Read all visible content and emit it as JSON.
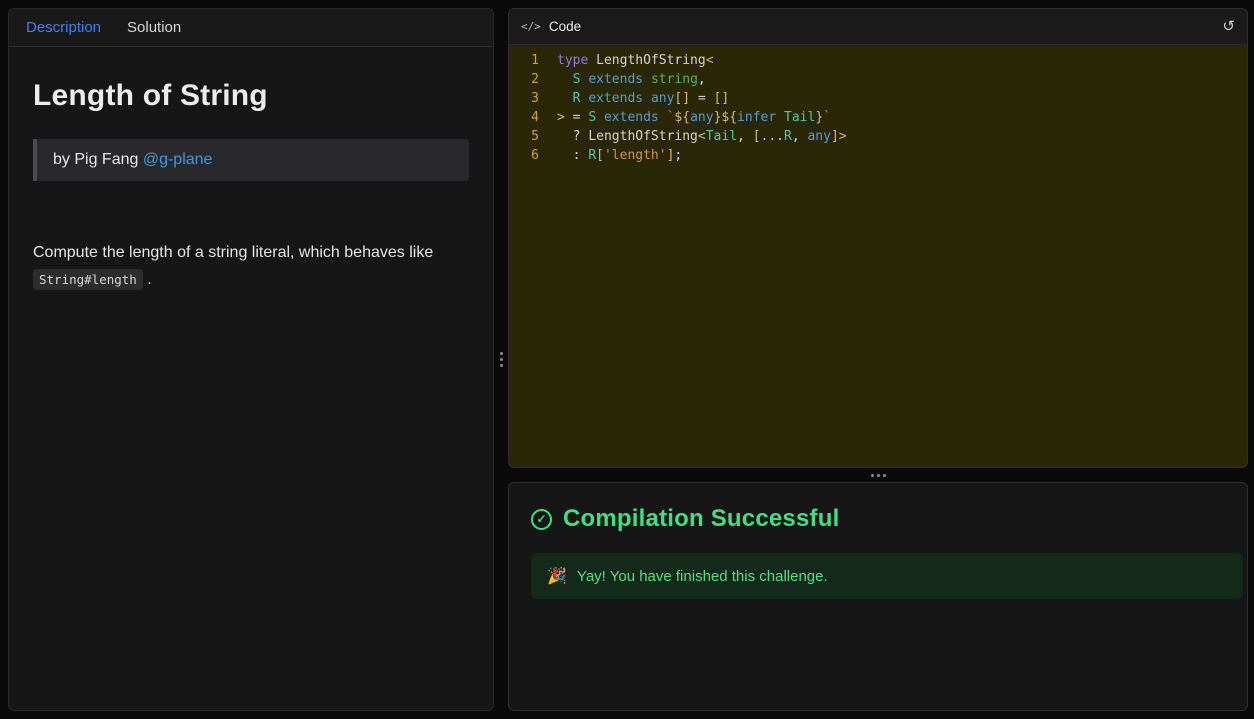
{
  "colors": {
    "accent_blue": "#3b82f6",
    "link_blue": "#3b9ae0",
    "success_green": "#3fe081",
    "editor_background": "#2a2706",
    "line_number": "#cfa43b"
  },
  "left_panel": {
    "tabs": [
      {
        "label": "Description",
        "active": true
      },
      {
        "label": "Solution",
        "active": false
      }
    ],
    "title": "Length of String",
    "byline": {
      "text": "by Pig Fang ",
      "link": "@g-plane"
    },
    "description": {
      "text": "Compute the length of a string literal, which behaves like ",
      "code": "String#length",
      "suffix": " ."
    }
  },
  "editor_panel": {
    "header": {
      "icon": "</>",
      "title": "Code",
      "reset_icon": "↺"
    },
    "code": {
      "lines": [
        {
          "num": "1",
          "tokens": [
            {
              "t": "type",
              "c": "kw2"
            },
            {
              "t": " ",
              "c": "pl"
            },
            {
              "t": "LengthOfString",
              "c": "pl"
            },
            {
              "t": "<",
              "c": "gold"
            }
          ]
        },
        {
          "num": "2",
          "tokens": [
            {
              "t": "  ",
              "c": "pl"
            },
            {
              "t": "S",
              "c": "tp"
            },
            {
              "t": " ",
              "c": "pl"
            },
            {
              "t": "extends",
              "c": "kw"
            },
            {
              "t": " ",
              "c": "pl"
            },
            {
              "t": "string",
              "c": "grn"
            },
            {
              "t": ",",
              "c": "pl"
            }
          ]
        },
        {
          "num": "3",
          "tokens": [
            {
              "t": "  ",
              "c": "pl"
            },
            {
              "t": "R",
              "c": "tp"
            },
            {
              "t": " ",
              "c": "pl"
            },
            {
              "t": "extends",
              "c": "kw"
            },
            {
              "t": " ",
              "c": "pl"
            },
            {
              "t": "any",
              "c": "kw"
            },
            {
              "t": "[]",
              "c": "gold"
            },
            {
              "t": " = ",
              "c": "pl"
            },
            {
              "t": "[]",
              "c": "gold"
            }
          ]
        },
        {
          "num": "4",
          "tokens": [
            {
              "t": ">",
              "c": "gold"
            },
            {
              "t": " = ",
              "c": "pl"
            },
            {
              "t": "S",
              "c": "tp"
            },
            {
              "t": " ",
              "c": "pl"
            },
            {
              "t": "extends",
              "c": "kw"
            },
            {
              "t": " ",
              "c": "pl"
            },
            {
              "t": "`",
              "c": "str"
            },
            {
              "t": "${",
              "c": "gold"
            },
            {
              "t": "any",
              "c": "kw"
            },
            {
              "t": "}",
              "c": "gold"
            },
            {
              "t": "${",
              "c": "gold"
            },
            {
              "t": "infer",
              "c": "kw"
            },
            {
              "t": " ",
              "c": "pl"
            },
            {
              "t": "Tail",
              "c": "tp"
            },
            {
              "t": "}",
              "c": "gold"
            },
            {
              "t": "`",
              "c": "str"
            }
          ]
        },
        {
          "num": "5",
          "tokens": [
            {
              "t": "  ? ",
              "c": "pl"
            },
            {
              "t": "LengthOfString",
              "c": "pl"
            },
            {
              "t": "<",
              "c": "gold"
            },
            {
              "t": "Tail",
              "c": "tp"
            },
            {
              "t": ", ",
              "c": "pl"
            },
            {
              "t": "[",
              "c": "gold"
            },
            {
              "t": "...",
              "c": "pl"
            },
            {
              "t": "R",
              "c": "tp"
            },
            {
              "t": ", ",
              "c": "pl"
            },
            {
              "t": "any",
              "c": "kw"
            },
            {
              "t": "]",
              "c": "gold"
            },
            {
              "t": ">",
              "c": "gold"
            }
          ]
        },
        {
          "num": "6",
          "tokens": [
            {
              "t": "  : ",
              "c": "pl"
            },
            {
              "t": "R",
              "c": "tp"
            },
            {
              "t": "[",
              "c": "gold"
            },
            {
              "t": "'length'",
              "c": "str"
            },
            {
              "t": "]",
              "c": "gold"
            },
            {
              "t": ";",
              "c": "pl"
            }
          ]
        }
      ]
    }
  },
  "results_panel": {
    "status_icon": "✓",
    "title": "Compilation Successful",
    "message_icon": "🎉",
    "message": "Yay! You have finished this challenge."
  }
}
